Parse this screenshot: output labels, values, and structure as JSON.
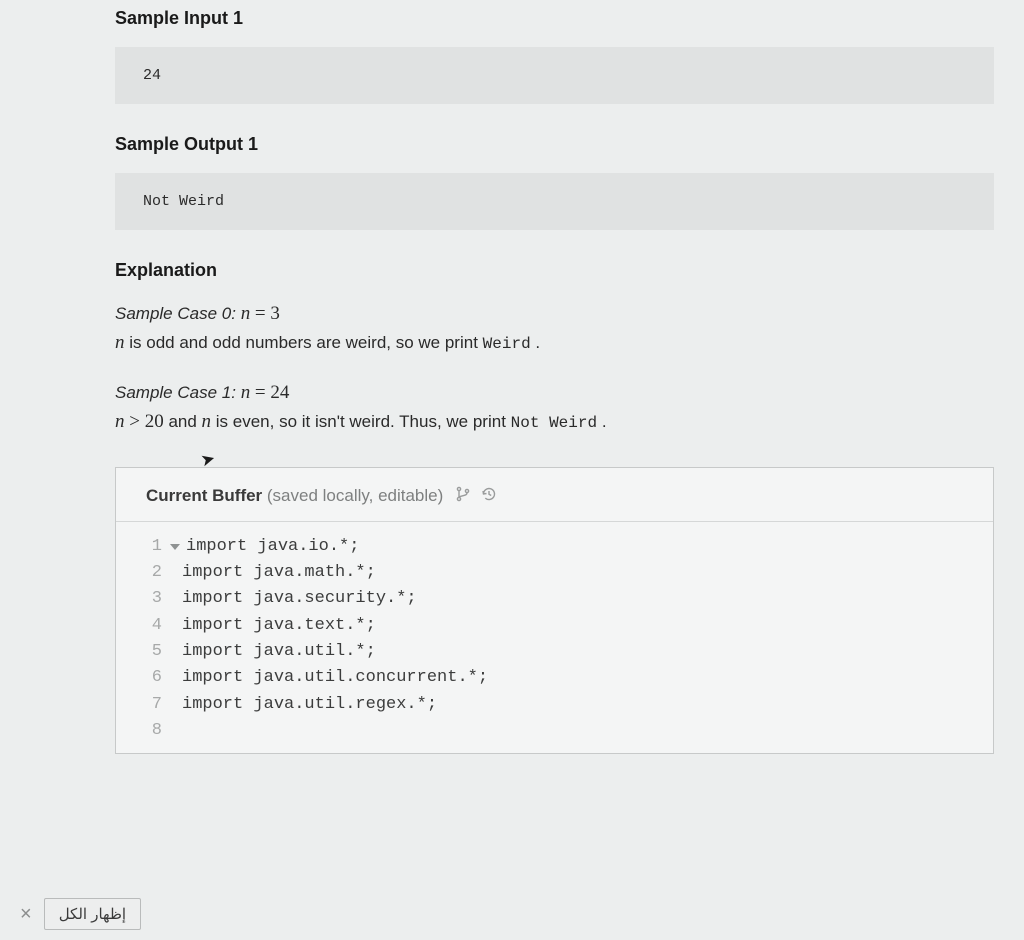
{
  "headings": {
    "sample_input": "Sample Input 1",
    "sample_output": "Sample Output 1",
    "explanation": "Explanation"
  },
  "samples": {
    "input_1": "24",
    "output_1": "Not Weird"
  },
  "explanation": {
    "case0": {
      "label": "Sample Case 0:",
      "equation_var": "n",
      "equation_op": "=",
      "equation_val": "3",
      "line": " is odd and odd numbers are weird, so we print ",
      "result": "Weird",
      "period": "."
    },
    "case1": {
      "label": "Sample Case 1:",
      "equation_var": "n",
      "equation_op": "=",
      "equation_val": "24",
      "line_a_var": "n",
      "line_a_op": ">",
      "line_a_val": "20",
      "line_mid": " and ",
      "line_var2": "n",
      "line_b": " is even, so it isn't weird. Thus, we print ",
      "result": "Not Weird",
      "period": "."
    }
  },
  "editor": {
    "title_strong": "Current Buffer",
    "title_soft": " (saved locally, editable)",
    "lines": [
      "import java.io.*;",
      "import java.math.*;",
      "import java.security.*;",
      "import java.text.*;",
      "import java.util.*;",
      "import java.util.concurrent.*;",
      "import java.util.regex.*;",
      ""
    ],
    "line_numbers": [
      "1",
      "2",
      "3",
      "4",
      "5",
      "6",
      "7",
      "8"
    ]
  },
  "footer": {
    "close_symbol": "×",
    "show_all_label": "إظهار الكل"
  }
}
